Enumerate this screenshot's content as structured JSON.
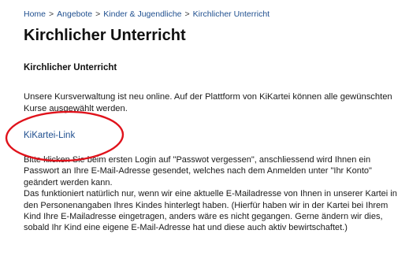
{
  "breadcrumb": {
    "items": [
      "Home",
      "Angebote",
      "Kinder & Jugendliche",
      "Kirchlicher Unterricht"
    ],
    "separator": ">"
  },
  "page": {
    "title": "Kirchlicher Unterricht",
    "subheading": "Kirchlicher Unterricht",
    "intro": "Unsere Kursverwaltung ist neu online. Auf der Plattform von KiKartei können alle gewünschten Kurse ausgewählt werden.",
    "link_label": "KiKartei-Link",
    "paragraph1": "Bitte klicken Sie beim ersten Login auf \"Passwot vergessen\", anschliessend wird Ihnen ein Passwort an Ihre E-Mail-Adresse gesendet, welches nach dem Anmelden unter \"Ihr Konto\" geändert werden kann.",
    "paragraph2": "Das funktioniert natürlich nur, wenn wir eine aktuelle E-Mailadresse von Ihnen in unserer Kartei in den Personenangaben Ihres Kindes hinterlegt haben. (Hierfür haben wir in der Kartei bei Ihrem Kind Ihre E-Mailadresse eingetragen, anders wäre es nicht gegangen. Gerne ändern wir dies, sobald Ihr Kind eine eigene E-Mail-Adresse hat und diese auch aktiv bewirtschaftet.)"
  },
  "colors": {
    "link": "#1f4f8f",
    "annotation": "#e0121b"
  }
}
